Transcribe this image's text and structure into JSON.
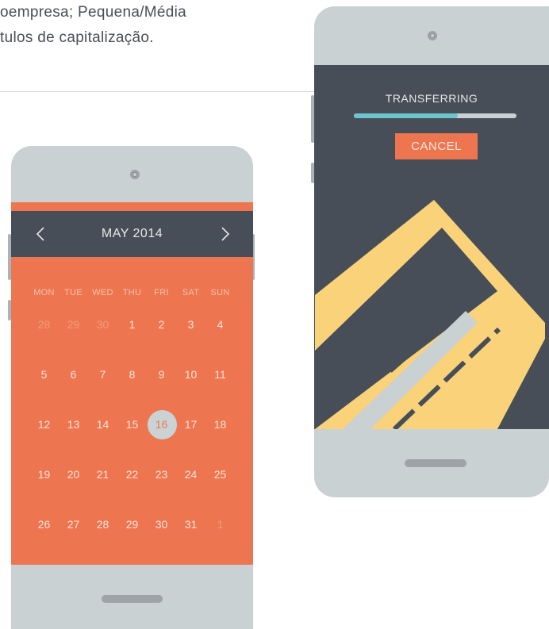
{
  "intro": {
    "line1": "oempresa; Pequena/Média",
    "line2": "tulos de capitalização."
  },
  "calendar": {
    "month_label": "MAY  2014",
    "prev_icon": "chevron-left-icon",
    "next_icon": "chevron-right-icon",
    "weekdays": [
      "MON",
      "TUE",
      "WED",
      "THU",
      "FRI",
      "SAT",
      "SUN"
    ],
    "days": [
      [
        "28",
        "29",
        "30",
        "1",
        "2",
        "3",
        "4"
      ],
      [
        "5",
        "6",
        "7",
        "8",
        "9",
        "10",
        "11"
      ],
      [
        "12",
        "13",
        "14",
        "15",
        "16",
        "17",
        "18"
      ],
      [
        "19",
        "20",
        "21",
        "22",
        "23",
        "24",
        "25"
      ],
      [
        "26",
        "27",
        "28",
        "29",
        "30",
        "31",
        "1"
      ]
    ],
    "muted_leading": 3,
    "muted_trailing": 1,
    "selected_day": "16",
    "colors": {
      "accent": "#ed7651",
      "header": "#474e57",
      "body": "#c9d1d3"
    }
  },
  "transfer": {
    "title": "TRANSFERRING",
    "progress": 0.64,
    "cancel_label": "CANCEL",
    "card_icon": "credit-card-icon",
    "colors": {
      "bar": "#6cc4cc",
      "card": "#fad27a",
      "button": "#ed7651"
    }
  }
}
